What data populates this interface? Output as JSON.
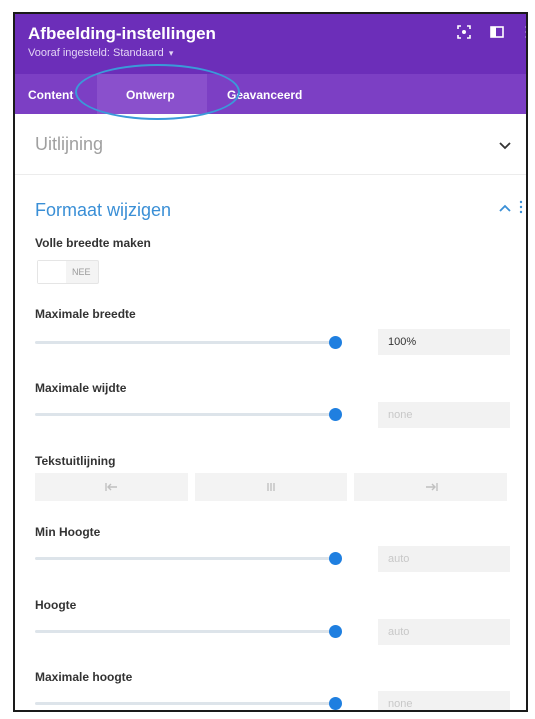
{
  "header": {
    "title": "Afbeelding-instellingen",
    "preset": "Vooraf ingesteld: Standaard",
    "preset_caret": "▾",
    "icons": [
      "expand-icon",
      "sidebar-layout-icon",
      "more-vertical-icon"
    ]
  },
  "tabs": [
    {
      "label": "Content",
      "active": false
    },
    {
      "label": "Ontwerp",
      "active": true
    },
    {
      "label": "Geavanceerd",
      "active": false
    }
  ],
  "sections": {
    "alignment": {
      "title": "Uitlijning",
      "expanded": false
    },
    "sizing": {
      "title": "Formaat wijzigen",
      "expanded": true
    }
  },
  "fields": {
    "full_width": {
      "label": "Volle breedte maken",
      "toggle_text": "NEE",
      "on": false
    },
    "max_width": {
      "label": "Maximale breedte",
      "value": "100%",
      "slider_fraction": 1.0
    },
    "width": {
      "label": "Maximale wijdte",
      "value": "none",
      "slider_fraction": 1.0
    },
    "text_align": {
      "label": "Tekstuitlijning",
      "options": [
        "align-left-icon",
        "align-center-icon",
        "align-right-icon"
      ]
    },
    "min_height": {
      "label": "Min Hoogte",
      "value": "auto",
      "slider_fraction": 1.0
    },
    "height": {
      "label": "Hoogte",
      "value": "auto",
      "slider_fraction": 1.0
    },
    "max_height": {
      "label": "Maximale hoogte",
      "value": "none",
      "slider_fraction": 1.0
    }
  },
  "colors": {
    "header_purple": "#6c2eb9",
    "tab_purple": "#7c3fc4",
    "accent_blue": "#1f7fe0",
    "section_blue": "#3a8fd6",
    "annotation_ellipse": "#3a9ad9"
  }
}
